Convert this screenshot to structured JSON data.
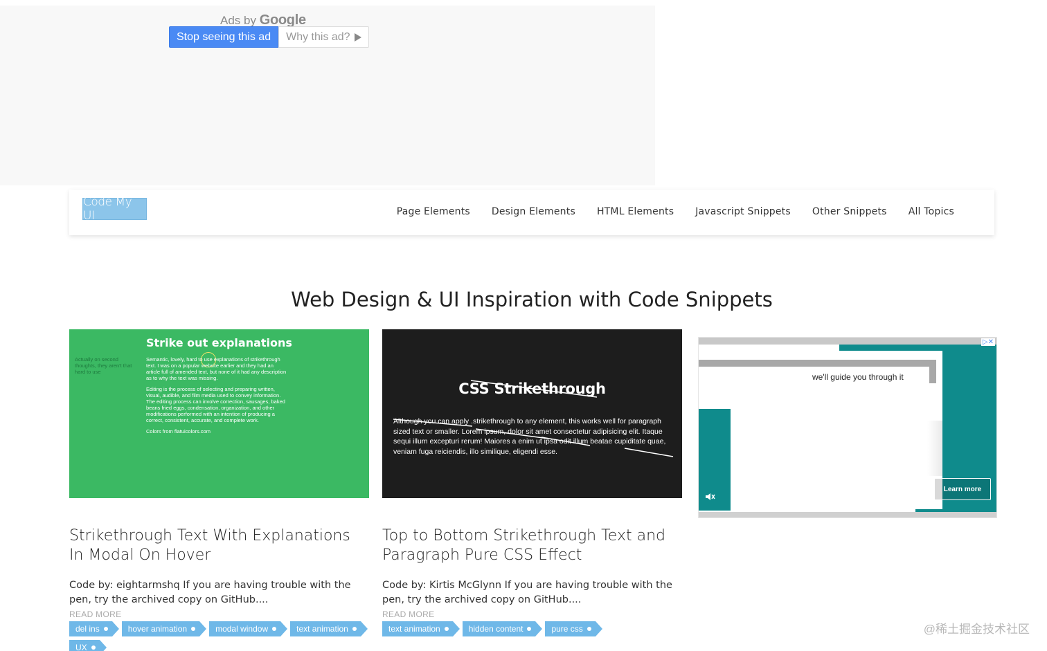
{
  "top_ad": {
    "ads_by": "Ads by",
    "google": "Google",
    "stop_label": "Stop seeing this ad",
    "why_label": "Why this ad?"
  },
  "header": {
    "logo": "Code My UI",
    "nav": [
      "Page Elements",
      "Design Elements",
      "HTML Elements",
      "Javascript Snippets",
      "Other Snippets",
      "All Topics"
    ]
  },
  "page_title": "Web Design & UI Inspiration with Code Snippets",
  "cards": [
    {
      "thumb_title": "Strike out explanations",
      "thumb_side": "Actually on second thoughts, they aren't that hard to use",
      "thumb_p1": "Semantic, lovely, hard to use explanations of strikethrough text. I was on a popular website earlier and they had an article full of amended text, but none of it had any description as to why the text was missing.",
      "thumb_p2": "Editing is the process of selecting and preparing written, visual, audible, and film media used to convey information. The editing process can involve correction, sausages, baked beans fried eggs, condensation, organization, and other modifications performed with an intention of producing a correct, consistent, accurate, and complete work.",
      "thumb_p3": "Colors from flatuicolors.com",
      "title": "Strikethrough Text With Explanations In Modal On Hover",
      "excerpt": "Code by: eightarmshq If you are having trouble with the pen, try the archived copy on GitHub....",
      "read_more": "READ MORE",
      "tags": [
        "del ins",
        "hover animation",
        "modal window",
        "text animation",
        "UX"
      ]
    },
    {
      "thumb_title": "CSS Strikethrough",
      "thumb_text": "Although you can apply .strikethrough to any element, this works well for paragraph sized text or smaller. Lorem ipsum, dolor sit amet consectetur adipisicing elit. Itaque sequi illum excepturi rerum! Maiores a enim ut ipsa odit illum beatae cupiditate quae, veniam fuga reiciendis, illo similique, eligendi esse.",
      "title": "Top to Bottom Strikethrough Text and Paragraph Pure CSS Effect",
      "excerpt": "Code by: Kirtis McGlynn If you are having trouble with the pen, try the archived copy on GitHub....",
      "read_more": "READ MORE",
      "tags": [
        "text animation",
        "hidden content",
        "pure css"
      ]
    }
  ],
  "right_ad": {
    "text": "we'll guide you through it",
    "learn_more": "Learn more"
  },
  "watermark": "@稀土掘金技术社区"
}
